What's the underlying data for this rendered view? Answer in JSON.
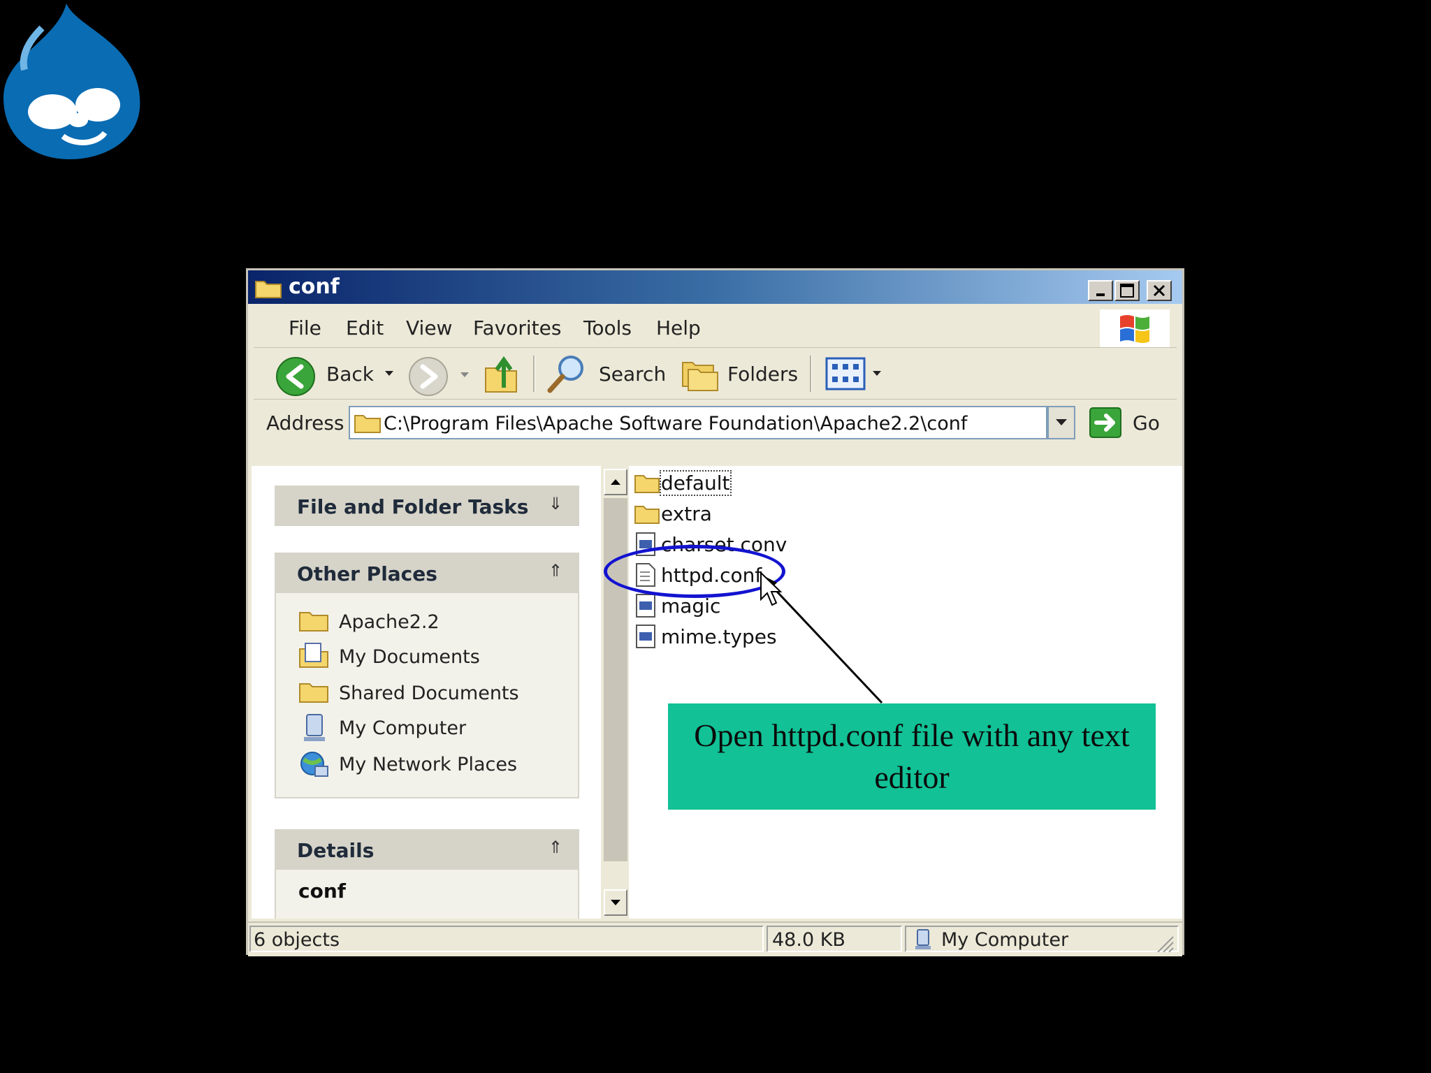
{
  "window": {
    "title": "conf",
    "menu": [
      "File",
      "Edit",
      "View",
      "Favorites",
      "Tools",
      "Help"
    ],
    "toolbar": {
      "back": "Back",
      "search": "Search",
      "folders": "Folders"
    },
    "address": {
      "label": "Address",
      "value": "C:\\Program Files\\Apache Software Foundation\\Apache2.2\\conf",
      "go": "Go"
    }
  },
  "left_pane": {
    "tasks_title": "File and Folder Tasks",
    "other_places_title": "Other Places",
    "other_places": [
      {
        "label": "Apache2.2",
        "icon": "folder-icon"
      },
      {
        "label": "My Documents",
        "icon": "my-documents-icon"
      },
      {
        "label": "Shared Documents",
        "icon": "folder-icon"
      },
      {
        "label": "My Computer",
        "icon": "my-computer-icon"
      },
      {
        "label": "My Network Places",
        "icon": "network-places-icon"
      }
    ],
    "details_title": "Details",
    "details_name": "conf"
  },
  "files": [
    {
      "name": "default",
      "icon": "folder-icon"
    },
    {
      "name": "extra",
      "icon": "folder-icon"
    },
    {
      "name": "charset.conv",
      "icon": "system-file-icon"
    },
    {
      "name": "httpd.conf",
      "icon": "text-file-icon"
    },
    {
      "name": "magic",
      "icon": "system-file-icon"
    },
    {
      "name": "mime.types",
      "icon": "system-file-icon"
    }
  ],
  "annotation": {
    "callout": "Open httpd.conf file with any text editor"
  },
  "status": {
    "objects": "6 objects",
    "size": "48.0 KB",
    "zone": "My Computer"
  },
  "colors": {
    "callout_bg": "#12c196",
    "highlight_ellipse": "#1313d0",
    "title_bar": "#0a246a"
  }
}
